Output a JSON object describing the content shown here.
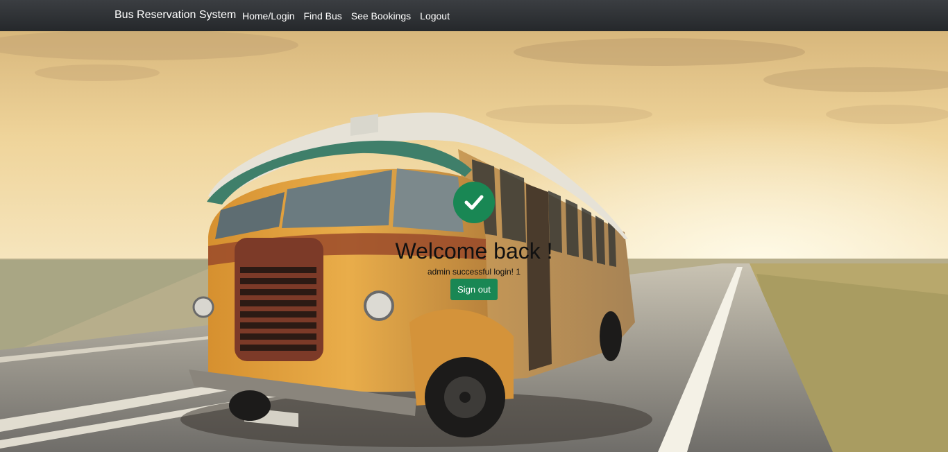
{
  "navbar": {
    "brand": "Bus Reservation System",
    "links": [
      {
        "label": "Home/Login"
      },
      {
        "label": "Find Bus"
      },
      {
        "label": "See Bookings"
      },
      {
        "label": "Logout"
      }
    ]
  },
  "welcome": {
    "icon": "check-circle-icon",
    "title": "Welcome back !",
    "message": "admin successful login! 1",
    "signout_label": "Sign out"
  },
  "colors": {
    "navbar": "#2f3236",
    "success": "#198754",
    "bus_body": "#e0a23c",
    "sky": "#f2d79a"
  }
}
